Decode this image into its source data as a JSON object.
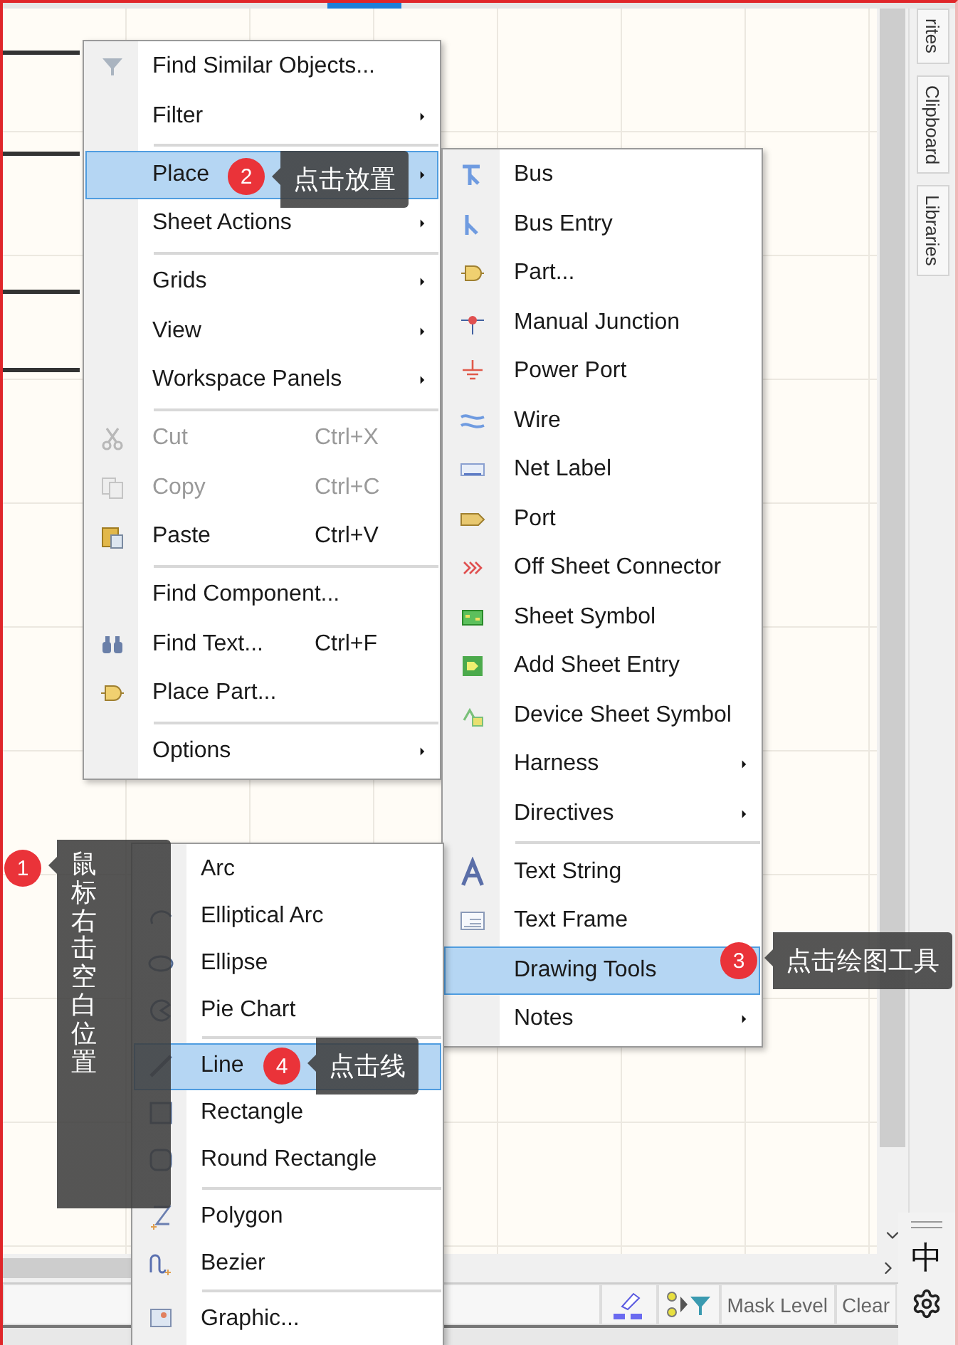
{
  "main_menu": {
    "items": [
      {
        "kind": "item",
        "label": "Find Similar Objects...",
        "submenu": false,
        "disabled": false,
        "selected": false
      },
      {
        "kind": "item",
        "label": "Filter",
        "submenu": true,
        "disabled": false,
        "selected": false
      },
      {
        "kind": "separator"
      },
      {
        "kind": "item",
        "label": "Place",
        "submenu": true,
        "disabled": false,
        "selected": true
      },
      {
        "kind": "item",
        "label": "Sheet Actions",
        "submenu": true,
        "disabled": false,
        "selected": false
      },
      {
        "kind": "separator"
      },
      {
        "kind": "item",
        "label": "Grids",
        "submenu": true,
        "disabled": false,
        "selected": false
      },
      {
        "kind": "item",
        "label": "View",
        "submenu": true,
        "disabled": false,
        "selected": false
      },
      {
        "kind": "item",
        "label": "Workspace Panels",
        "submenu": true,
        "disabled": false,
        "selected": false
      },
      {
        "kind": "separator"
      },
      {
        "kind": "item",
        "label": "Cut",
        "shortcut": "Ctrl+X",
        "submenu": false,
        "disabled": true,
        "selected": false
      },
      {
        "kind": "item",
        "label": "Copy",
        "shortcut": "Ctrl+C",
        "submenu": false,
        "disabled": true,
        "selected": false
      },
      {
        "kind": "item",
        "label": "Paste",
        "shortcut": "Ctrl+V",
        "submenu": false,
        "disabled": false,
        "selected": false
      },
      {
        "kind": "separator"
      },
      {
        "kind": "item",
        "label": "Find Component...",
        "submenu": false,
        "disabled": false,
        "selected": false
      },
      {
        "kind": "item",
        "label": "Find Text...",
        "shortcut": "Ctrl+F",
        "submenu": false,
        "disabled": false,
        "selected": false
      },
      {
        "kind": "item",
        "label": "Place Part...",
        "submenu": false,
        "disabled": false,
        "selected": false
      },
      {
        "kind": "separator"
      },
      {
        "kind": "item",
        "label": "Options",
        "submenu": true,
        "disabled": false,
        "selected": false
      }
    ]
  },
  "place_menu": {
    "items": [
      {
        "kind": "item",
        "label": "Bus",
        "submenu": false,
        "selected": false
      },
      {
        "kind": "item",
        "label": "Bus Entry",
        "submenu": false,
        "selected": false
      },
      {
        "kind": "item",
        "label": "Part...",
        "submenu": false,
        "selected": false
      },
      {
        "kind": "item",
        "label": "Manual Junction",
        "submenu": false,
        "selected": false
      },
      {
        "kind": "item",
        "label": "Power Port",
        "submenu": false,
        "selected": false
      },
      {
        "kind": "item",
        "label": "Wire",
        "submenu": false,
        "selected": false
      },
      {
        "kind": "item",
        "label": "Net Label",
        "submenu": false,
        "selected": false
      },
      {
        "kind": "item",
        "label": "Port",
        "submenu": false,
        "selected": false
      },
      {
        "kind": "item",
        "label": "Off Sheet Connector",
        "submenu": false,
        "selected": false
      },
      {
        "kind": "item",
        "label": "Sheet Symbol",
        "submenu": false,
        "selected": false
      },
      {
        "kind": "item",
        "label": "Add Sheet Entry",
        "submenu": false,
        "selected": false
      },
      {
        "kind": "item",
        "label": "Device Sheet Symbol",
        "submenu": false,
        "selected": false
      },
      {
        "kind": "item",
        "label": "Harness",
        "submenu": true,
        "selected": false
      },
      {
        "kind": "item",
        "label": "Directives",
        "submenu": true,
        "selected": false
      },
      {
        "kind": "separator"
      },
      {
        "kind": "item",
        "label": "Text String",
        "submenu": false,
        "selected": false
      },
      {
        "kind": "item",
        "label": "Text Frame",
        "submenu": false,
        "selected": false
      },
      {
        "kind": "item",
        "label": "Drawing Tools",
        "submenu": false,
        "selected": true
      },
      {
        "kind": "item",
        "label": "Notes",
        "submenu": true,
        "selected": false
      }
    ]
  },
  "drawing_menu": {
    "items": [
      {
        "kind": "item",
        "label": "Arc",
        "selected": false
      },
      {
        "kind": "item",
        "label": "Elliptical Arc",
        "selected": false
      },
      {
        "kind": "item",
        "label": "Ellipse",
        "selected": false
      },
      {
        "kind": "item",
        "label": "Pie Chart",
        "selected": false
      },
      {
        "kind": "separator"
      },
      {
        "kind": "item",
        "label": "Line",
        "selected": true
      },
      {
        "kind": "item",
        "label": "Rectangle",
        "selected": false
      },
      {
        "kind": "item",
        "label": "Round Rectangle",
        "selected": false
      },
      {
        "kind": "separator"
      },
      {
        "kind": "item",
        "label": "Polygon",
        "selected": false
      },
      {
        "kind": "item",
        "label": "Bezier",
        "selected": false
      },
      {
        "kind": "separator"
      },
      {
        "kind": "item",
        "label": "Graphic...",
        "selected": false
      }
    ]
  },
  "callouts": [
    {
      "number": "1",
      "text": "鼠标右击空白位置"
    },
    {
      "number": "2",
      "text": "点击放置"
    },
    {
      "number": "3",
      "text": "点击绘图工具"
    },
    {
      "number": "4",
      "text": "点击线"
    }
  ],
  "side_tabs": [
    "rites",
    "Clipboard",
    "Libraries"
  ],
  "status_bar": {
    "buttons": [
      "Mask Level",
      "Clear"
    ]
  },
  "ime": {
    "label": "中"
  }
}
